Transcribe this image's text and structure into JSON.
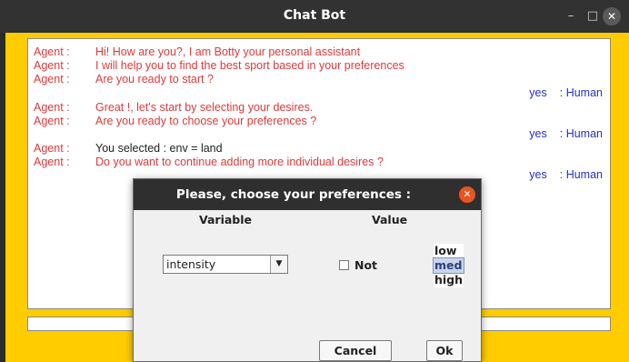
{
  "window": {
    "title": "Chat Bot",
    "minimize_glyph": "–",
    "maximize_glyph": "□",
    "close_glyph": "✕"
  },
  "chat": {
    "messages": [
      {
        "role": "agent",
        "label": "Agent :",
        "text": "Hi! How are you?, I am Botty your personal assistant"
      },
      {
        "role": "agent",
        "label": "Agent :",
        "text": "I will help you to find the best sport based in your preferences"
      },
      {
        "role": "agent",
        "label": "Agent :",
        "text": "Are you ready to start ?"
      },
      {
        "role": "human",
        "text": "yes",
        "label": ": Human"
      },
      {
        "role": "agent",
        "label": "Agent :",
        "text": "Great !, let's start by selecting your desires."
      },
      {
        "role": "agent",
        "label": "Agent :",
        "text": "Are you ready to choose your preferences ?"
      },
      {
        "role": "human",
        "text": "yes",
        "label": ": Human"
      },
      {
        "role": "agent",
        "label": "Agent :",
        "text": "You selected : env = land"
      },
      {
        "role": "agent",
        "label": "Agent :",
        "text": "Do you want to continue adding more individual desires ?"
      },
      {
        "role": "human",
        "text": "yes",
        "label": ": Human"
      }
    ]
  },
  "input": {
    "value": ""
  },
  "dialog": {
    "title": "Please, choose your preferences :",
    "close_glyph": "✕",
    "variable_header": "Variable",
    "value_header": "Value",
    "variable_selected": "intensity",
    "dropdown_glyph": "▼",
    "not_label": "Not",
    "not_checked": false,
    "levels": [
      "low",
      "med",
      "high"
    ],
    "selected_level": "med",
    "cancel_label": "Cancel",
    "ok_label": "Ok"
  },
  "colors": {
    "frame": "#ffcc00",
    "agent_text": "#e0393a",
    "human_text": "#2431c9",
    "titlebar": "#323232",
    "dialog_close": "#e95420"
  }
}
